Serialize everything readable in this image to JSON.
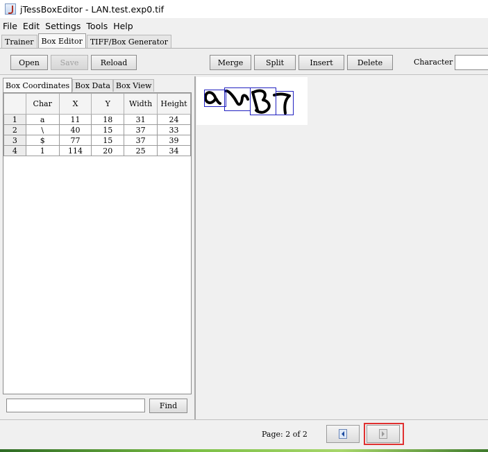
{
  "window": {
    "title": "jTessBoxEditor - LAN.test.exp0.tif"
  },
  "menu": [
    "File",
    "Edit",
    "Settings",
    "Tools",
    "Help"
  ],
  "main_tabs": [
    "Trainer",
    "Box Editor",
    "TIFF/Box Generator"
  ],
  "toolbar": {
    "open": "Open",
    "save": "Save",
    "reload": "Reload",
    "merge": "Merge",
    "split": "Split",
    "insert": "Insert",
    "delete": "Delete",
    "character_label": "Character"
  },
  "sub_tabs": [
    "Box Coordinates",
    "Box Data",
    "Box View"
  ],
  "table": {
    "headers": [
      "Char",
      "X",
      "Y",
      "Width",
      "Height"
    ],
    "rows": [
      [
        "1",
        "a",
        "11",
        "18",
        "31",
        "24"
      ],
      [
        "2",
        "\\",
        "40",
        "15",
        "37",
        "33"
      ],
      [
        "3",
        "$",
        "77",
        "15",
        "37",
        "39"
      ],
      [
        "4",
        "1",
        "114",
        "20",
        "25",
        "34"
      ]
    ]
  },
  "find": {
    "button": "Find",
    "value": ""
  },
  "pagination": {
    "label": "Page: 2 of 2"
  },
  "colors": {
    "box_outline": "#2020c0",
    "highlight": "#e03030"
  },
  "icons": {
    "prev": "arrow-left-icon",
    "next": "arrow-right-icon"
  }
}
